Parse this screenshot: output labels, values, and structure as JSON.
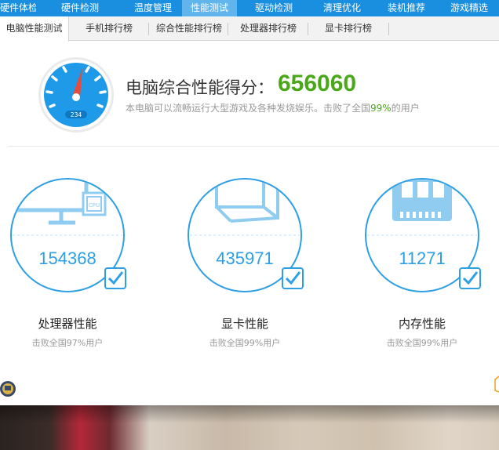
{
  "topnav": {
    "tabs": [
      "硬件体检",
      "硬件检测",
      "温度管理",
      "性能测试",
      "驱动检测",
      "清理优化",
      "装机推荐",
      "游戏精选"
    ]
  },
  "subnav": {
    "tabs": [
      "电脑性能测试",
      "手机排行榜",
      "综合性能排行榜",
      "处理器排行榜",
      "显卡排行榜"
    ]
  },
  "header": {
    "gauge_number": "234",
    "title": "电脑综合性能得分：",
    "score": "656060",
    "desc_prefix": "本电脑可以流畅运行大型游戏及各种发烧娱乐。击败了全国",
    "desc_pct": "99%",
    "desc_suffix": "的用户",
    "gauge_icon": "speedometer-icon"
  },
  "cards": [
    {
      "icon": "monitor-cpu-icon",
      "value": "154368",
      "label": "处理器性能",
      "sub": "击败全国97%用户",
      "cpu_text": "CPU"
    },
    {
      "icon": "graphics-card-icon",
      "value": "435971",
      "label": "显卡性能",
      "sub": "击败全国99%用户"
    },
    {
      "icon": "memory-icon",
      "value": "11271",
      "label": "内存性能",
      "sub": "击败全国99%用户"
    }
  ],
  "colors": {
    "nav_blue": "#1a8fe0",
    "accent_blue": "#2d9fe4",
    "score_green": "#49a817"
  }
}
